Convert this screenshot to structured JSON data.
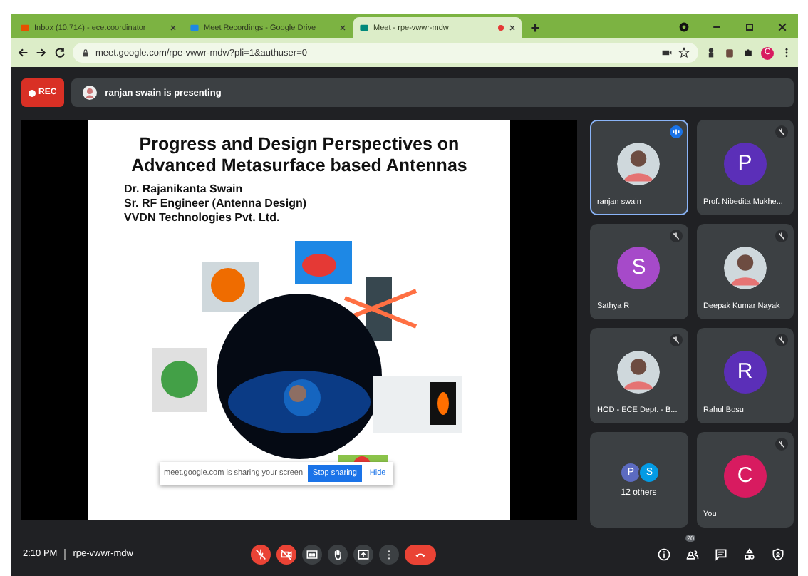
{
  "browser": {
    "tabs": [
      {
        "label": "Inbox (10,714) - ece.coordinator",
        "selected": false
      },
      {
        "label": "Meet Recordings - Google Drive",
        "selected": false
      },
      {
        "label": "Meet - rpe-vwwr-mdw",
        "selected": true,
        "recording": true
      }
    ],
    "address": "meet.google.com/rpe-vwwr-mdw?pli=1&authuser=0",
    "profile_initial": "C"
  },
  "meeting": {
    "recording_label": "REC",
    "presenting_text": "ranjan swain is presenting"
  },
  "slide": {
    "title_lines": [
      "Progress and Design Perspectives on",
      "Advanced Metasurface based Antennas"
    ],
    "author_lines": [
      "Dr. Rajanikanta Swain",
      "Sr. RF Engineer (Antenna Design)",
      "VVDN Technologies Pvt. Ltd."
    ],
    "share_notice": {
      "text": "meet.google.com is sharing your screen",
      "stop_button": "Stop sharing",
      "hide_button": "Hide"
    }
  },
  "participants": [
    {
      "name": "ranjan swain",
      "muted": false,
      "speaking": true
    },
    {
      "kind": "letter",
      "name": "Prof. Nibedita Mukhe...",
      "initial": "P",
      "color": "#5b2fb8",
      "muted": true,
      "speaking": false
    },
    {
      "kind": "letter",
      "name": "Sathya R",
      "initial": "S",
      "color": "#a64ac9",
      "muted": true,
      "speaking": false
    },
    {
      "name": "Deepak Kumar Nayak",
      "muted": true,
      "speaking": false
    },
    {
      "name": "HOD - ECE Dept. - B...",
      "muted": true,
      "speaking": false
    },
    {
      "kind": "letter",
      "name": "Rahul Bosu",
      "initial": "R",
      "color": "#5b2fb8",
      "muted": true,
      "speaking": false
    },
    {
      "kind": "others",
      "name": "12 others",
      "avatars": [
        {
          "initial": "P",
          "color": "#5c6bc0"
        },
        {
          "initial": "S",
          "color": "#039be5"
        }
      ]
    },
    {
      "kind": "letter",
      "name": "You",
      "initial": "C",
      "color": "#d81b60",
      "muted": true,
      "speaking": false
    }
  ],
  "bottom_bar": {
    "time": "2:10 PM",
    "meeting_code": "rpe-vwwr-mdw",
    "controls": [
      {
        "kind": "mic",
        "on": false
      },
      {
        "kind": "camera",
        "on": false
      },
      {
        "kind": "captions"
      },
      {
        "kind": "hand"
      },
      {
        "kind": "present"
      },
      {
        "kind": "more"
      },
      {
        "kind": "end"
      }
    ],
    "side_controls": [
      {
        "kind": "info"
      },
      {
        "kind": "people",
        "badge": "20"
      },
      {
        "kind": "chat"
      },
      {
        "kind": "activities"
      },
      {
        "kind": "host"
      }
    ]
  }
}
